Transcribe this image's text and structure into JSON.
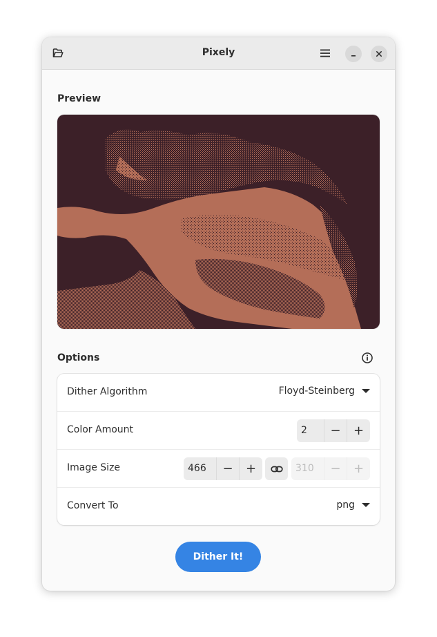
{
  "window": {
    "title": "Pixely"
  },
  "icons": {
    "open": "folder-open-icon",
    "menu": "hamburger-menu-icon",
    "minimize": "minimize-icon",
    "close": "close-icon",
    "info": "info-icon",
    "link": "link-icon",
    "dropdown": "chevron-down-icon"
  },
  "preview": {
    "label": "Preview",
    "colors": {
      "dark": "#3c2028",
      "light": "#b46e58"
    }
  },
  "options": {
    "label": "Options",
    "dither_algorithm": {
      "label": "Dither Algorithm",
      "value": "Floyd-Steinberg"
    },
    "color_amount": {
      "label": "Color Amount",
      "value": "2",
      "minus": "−",
      "plus": "+"
    },
    "image_size": {
      "label": "Image Size",
      "width": "466",
      "height": "310",
      "minus": "−",
      "plus": "+"
    },
    "convert_to": {
      "label": "Convert To",
      "value": "png"
    }
  },
  "action": {
    "label": "Dither It!"
  },
  "colors": {
    "accent": "#3584e4"
  }
}
